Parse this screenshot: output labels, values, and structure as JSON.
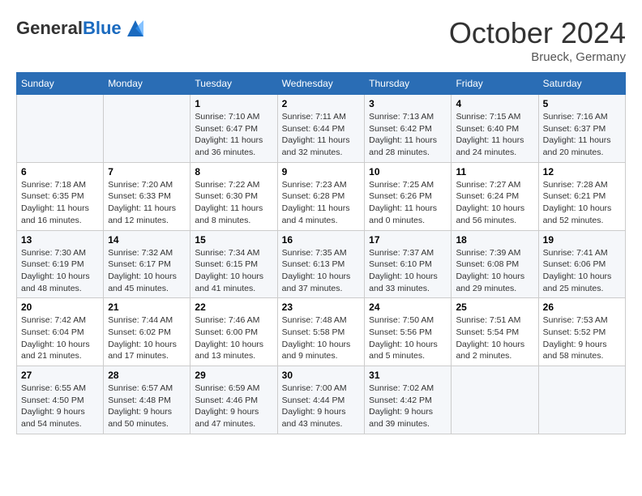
{
  "header": {
    "logo_general": "General",
    "logo_blue": "Blue",
    "month": "October 2024",
    "location": "Brueck, Germany"
  },
  "weekdays": [
    "Sunday",
    "Monday",
    "Tuesday",
    "Wednesday",
    "Thursday",
    "Friday",
    "Saturday"
  ],
  "weeks": [
    [
      {
        "day": "",
        "info": ""
      },
      {
        "day": "",
        "info": ""
      },
      {
        "day": "1",
        "info": "Sunrise: 7:10 AM\nSunset: 6:47 PM\nDaylight: 11 hours and 36 minutes."
      },
      {
        "day": "2",
        "info": "Sunrise: 7:11 AM\nSunset: 6:44 PM\nDaylight: 11 hours and 32 minutes."
      },
      {
        "day": "3",
        "info": "Sunrise: 7:13 AM\nSunset: 6:42 PM\nDaylight: 11 hours and 28 minutes."
      },
      {
        "day": "4",
        "info": "Sunrise: 7:15 AM\nSunset: 6:40 PM\nDaylight: 11 hours and 24 minutes."
      },
      {
        "day": "5",
        "info": "Sunrise: 7:16 AM\nSunset: 6:37 PM\nDaylight: 11 hours and 20 minutes."
      }
    ],
    [
      {
        "day": "6",
        "info": "Sunrise: 7:18 AM\nSunset: 6:35 PM\nDaylight: 11 hours and 16 minutes."
      },
      {
        "day": "7",
        "info": "Sunrise: 7:20 AM\nSunset: 6:33 PM\nDaylight: 11 hours and 12 minutes."
      },
      {
        "day": "8",
        "info": "Sunrise: 7:22 AM\nSunset: 6:30 PM\nDaylight: 11 hours and 8 minutes."
      },
      {
        "day": "9",
        "info": "Sunrise: 7:23 AM\nSunset: 6:28 PM\nDaylight: 11 hours and 4 minutes."
      },
      {
        "day": "10",
        "info": "Sunrise: 7:25 AM\nSunset: 6:26 PM\nDaylight: 11 hours and 0 minutes."
      },
      {
        "day": "11",
        "info": "Sunrise: 7:27 AM\nSunset: 6:24 PM\nDaylight: 10 hours and 56 minutes."
      },
      {
        "day": "12",
        "info": "Sunrise: 7:28 AM\nSunset: 6:21 PM\nDaylight: 10 hours and 52 minutes."
      }
    ],
    [
      {
        "day": "13",
        "info": "Sunrise: 7:30 AM\nSunset: 6:19 PM\nDaylight: 10 hours and 48 minutes."
      },
      {
        "day": "14",
        "info": "Sunrise: 7:32 AM\nSunset: 6:17 PM\nDaylight: 10 hours and 45 minutes."
      },
      {
        "day": "15",
        "info": "Sunrise: 7:34 AM\nSunset: 6:15 PM\nDaylight: 10 hours and 41 minutes."
      },
      {
        "day": "16",
        "info": "Sunrise: 7:35 AM\nSunset: 6:13 PM\nDaylight: 10 hours and 37 minutes."
      },
      {
        "day": "17",
        "info": "Sunrise: 7:37 AM\nSunset: 6:10 PM\nDaylight: 10 hours and 33 minutes."
      },
      {
        "day": "18",
        "info": "Sunrise: 7:39 AM\nSunset: 6:08 PM\nDaylight: 10 hours and 29 minutes."
      },
      {
        "day": "19",
        "info": "Sunrise: 7:41 AM\nSunset: 6:06 PM\nDaylight: 10 hours and 25 minutes."
      }
    ],
    [
      {
        "day": "20",
        "info": "Sunrise: 7:42 AM\nSunset: 6:04 PM\nDaylight: 10 hours and 21 minutes."
      },
      {
        "day": "21",
        "info": "Sunrise: 7:44 AM\nSunset: 6:02 PM\nDaylight: 10 hours and 17 minutes."
      },
      {
        "day": "22",
        "info": "Sunrise: 7:46 AM\nSunset: 6:00 PM\nDaylight: 10 hours and 13 minutes."
      },
      {
        "day": "23",
        "info": "Sunrise: 7:48 AM\nSunset: 5:58 PM\nDaylight: 10 hours and 9 minutes."
      },
      {
        "day": "24",
        "info": "Sunrise: 7:50 AM\nSunset: 5:56 PM\nDaylight: 10 hours and 5 minutes."
      },
      {
        "day": "25",
        "info": "Sunrise: 7:51 AM\nSunset: 5:54 PM\nDaylight: 10 hours and 2 minutes."
      },
      {
        "day": "26",
        "info": "Sunrise: 7:53 AM\nSunset: 5:52 PM\nDaylight: 9 hours and 58 minutes."
      }
    ],
    [
      {
        "day": "27",
        "info": "Sunrise: 6:55 AM\nSunset: 4:50 PM\nDaylight: 9 hours and 54 minutes."
      },
      {
        "day": "28",
        "info": "Sunrise: 6:57 AM\nSunset: 4:48 PM\nDaylight: 9 hours and 50 minutes."
      },
      {
        "day": "29",
        "info": "Sunrise: 6:59 AM\nSunset: 4:46 PM\nDaylight: 9 hours and 47 minutes."
      },
      {
        "day": "30",
        "info": "Sunrise: 7:00 AM\nSunset: 4:44 PM\nDaylight: 9 hours and 43 minutes."
      },
      {
        "day": "31",
        "info": "Sunrise: 7:02 AM\nSunset: 4:42 PM\nDaylight: 9 hours and 39 minutes."
      },
      {
        "day": "",
        "info": ""
      },
      {
        "day": "",
        "info": ""
      }
    ]
  ]
}
